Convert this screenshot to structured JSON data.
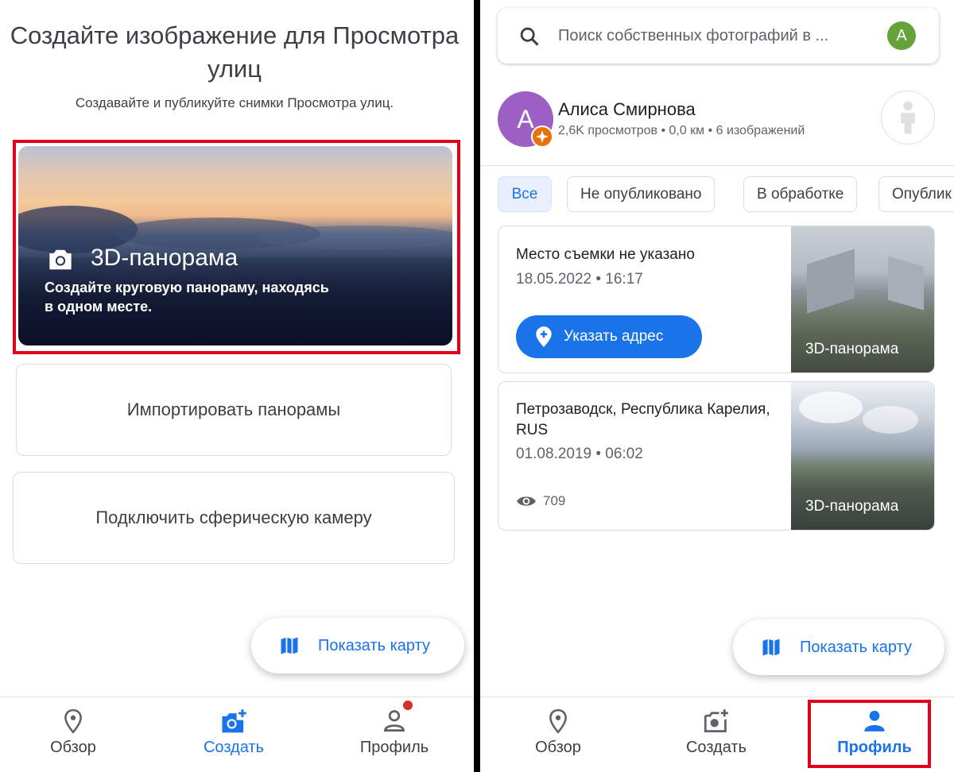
{
  "left": {
    "title": "Создайте изображение для Просмотра улиц",
    "subtitle": "Создавайте и публикуйте снимки Просмотра улиц.",
    "pano_card": {
      "title": "3D-панорама",
      "description": "Создайте круговую панораму, находясь в одном месте.",
      "icon": "camera-icon"
    },
    "import_label": "Импортировать панорамы",
    "connect_label": "Подключить сферическую камеру",
    "map_button": {
      "label": "Показать карту",
      "icon": "map-icon"
    },
    "nav": [
      {
        "label": "Обзор",
        "icon": "location-pin-icon"
      },
      {
        "label": "Создать",
        "icon": "add-photo-icon",
        "active": true
      },
      {
        "label": "Профиль",
        "icon": "person-icon",
        "notification": true
      }
    ]
  },
  "right": {
    "search": {
      "placeholder": "Поиск собственных фотографий в ...",
      "avatar_letter": "A"
    },
    "profile": {
      "avatar_letter": "A",
      "name": "Алиса Смирнова",
      "stats": "2,6K просмотров • 0,0 км • 6 изображений"
    },
    "chips": [
      "Все",
      "Не опубликовано",
      "В обработке",
      "Опублик"
    ],
    "cards": [
      {
        "title": "Место съемки не указано",
        "date": "18.05.2022 • 16:17",
        "action": "Указать адрес",
        "thumb_label": "3D-панорама"
      },
      {
        "title": "Петрозаводск, Республика Карелия, RUS",
        "date": "01.08.2019 • 06:02",
        "views": "709",
        "thumb_label": "3D-панорама"
      }
    ],
    "map_button": {
      "label": "Показать карту",
      "icon": "map-icon"
    },
    "nav": [
      {
        "label": "Обзор",
        "icon": "location-pin-icon"
      },
      {
        "label": "Создать",
        "icon": "add-photo-icon"
      },
      {
        "label": "Профиль",
        "icon": "person-icon",
        "active": true
      }
    ]
  },
  "colors": {
    "accent": "#1a73e8",
    "highlight": "#e3001b",
    "avatar_green": "#65a23a",
    "avatar_purple": "#9c5fc4"
  }
}
